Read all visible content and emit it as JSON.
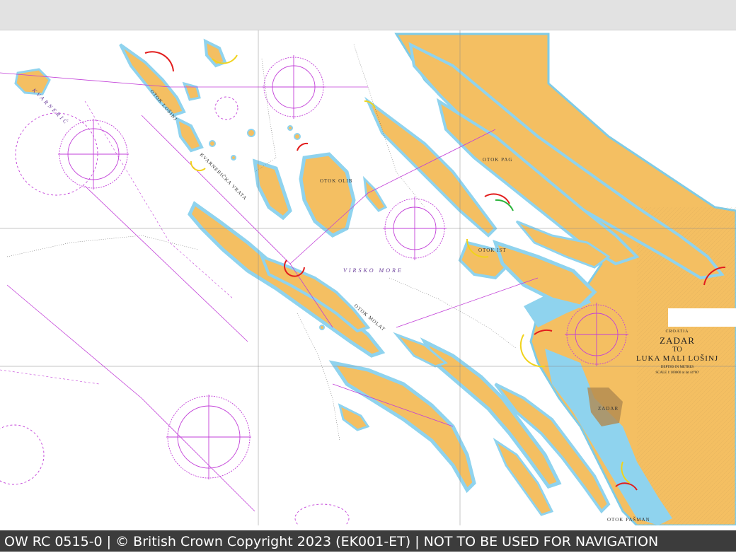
{
  "map": {
    "country": "CROATIA",
    "title_line1": "ZADAR",
    "title_line2": "TO",
    "title_line3": "LUKA MALI LOŠINJ",
    "depths_note": "DEPTHS IN METRES",
    "scale_note": "SCALE 1:100000 at lat 44°00'",
    "labels": {
      "otok_losinj": "OTOK LOŠINJ",
      "otok_olib": "OTOK OLIB",
      "otok_pag": "OTOK PAG",
      "otok_ist": "OTOK IST",
      "otok_molat": "OTOK MOLAT",
      "virsko_more": "VIRSKO MORE",
      "zadar": "ZADAR",
      "kvarneric": "KVARNERIĆ",
      "kvarnericka_vrata": "KVARNERIČKA VRATA",
      "otok_pasman": "OTOK PAŠMAN"
    },
    "colors": {
      "land": "#f4bf62",
      "shallow": "#8fd3ee",
      "sea": "#ffffff",
      "magenta": "#c23fd8",
      "light_red": "#e21d1d",
      "light_yellow": "#f1d31b",
      "light_green": "#2ab33a"
    }
  },
  "footer": {
    "text": "OW RC 0515-0 | © British Crown Copyright 2023 (EK001-ET) | NOT TO BE USED FOR NAVIGATION"
  }
}
